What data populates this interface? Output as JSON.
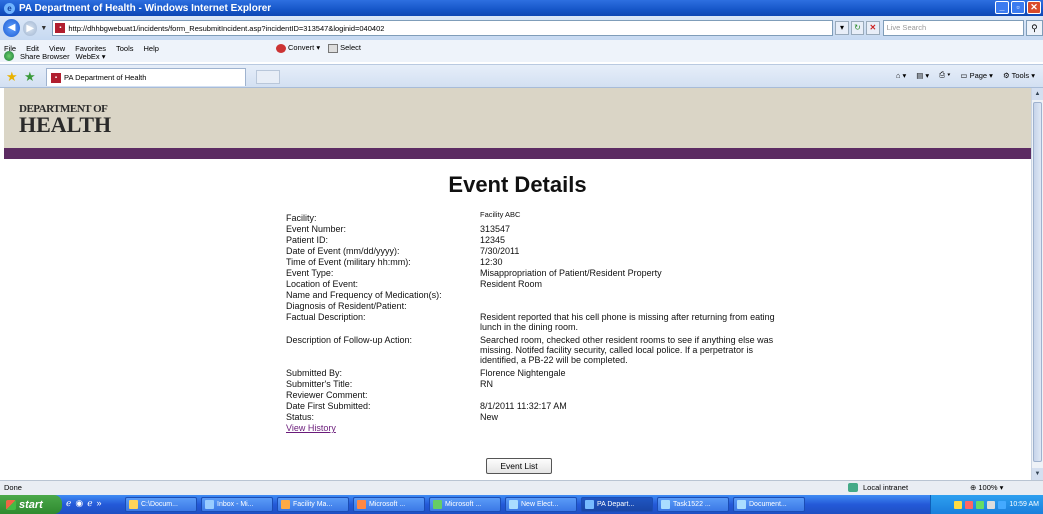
{
  "window": {
    "title": "PA Department of Health - Windows Internet Explorer"
  },
  "address": {
    "url": "http://dhhbgwebuat1/incidents/form_ResubmitIncident.asp?incidentID=313547&loginid=040402",
    "search_placeholder": "Live Search"
  },
  "menu": {
    "items": [
      "File",
      "Edit",
      "View",
      "Favorites",
      "Tools",
      "Help"
    ],
    "convert": "Convert",
    "select": "Select",
    "share": "Share Browser",
    "webex": "WebEx"
  },
  "tab": {
    "label": "PA Department of Health"
  },
  "commandbar": {
    "page": "Page",
    "tools": "Tools"
  },
  "logo": {
    "line1": "DEPARTMENT OF",
    "line2": "HEALTH"
  },
  "page": {
    "heading": "Event Details",
    "fields": [
      {
        "label": "Facility:",
        "value": "Facility ABC"
      },
      {
        "label": "Event Number:",
        "value": "313547"
      },
      {
        "label": "Patient ID:",
        "value": "12345"
      },
      {
        "label": "Date of Event (mm/dd/yyyy):",
        "value": "7/30/2011"
      },
      {
        "label": "Time of Event (military hh:mm):",
        "value": "12:30"
      },
      {
        "label": "Event Type:",
        "value": "Misappropriation of Patient/Resident Property"
      },
      {
        "label": "Location of Event:",
        "value": "Resident Room"
      },
      {
        "label": "Name and Frequency of Medication(s):",
        "value": ""
      },
      {
        "label": "Diagnosis of Resident/Patient:",
        "value": ""
      },
      {
        "label": "Factual Description:",
        "value": "Resident reported that his cell phone is missing after returning from eating lunch in the dining room."
      },
      {
        "label": "Description of Follow-up Action:",
        "value": "Searched room, checked other resident rooms to see if anything else was missing. Notifed facility security, called local police. If a perpetrator is identified, a PB-22 will be completed."
      },
      {
        "label": "Submitted By:",
        "value": "Florence Nightengale"
      },
      {
        "label": "Submitter's Title:",
        "value": "RN"
      },
      {
        "label": "Reviewer Comment:",
        "value": ""
      },
      {
        "label": "Date First Submitted:",
        "value": "8/1/2011 11:32:17 AM"
      },
      {
        "label": "Status:",
        "value": "New"
      }
    ],
    "history_link": "View History",
    "event_list_button": "Event List"
  },
  "status": {
    "text": "Done",
    "zone": "Local intranet",
    "zoom": "100%"
  },
  "taskbar": {
    "start": "start",
    "tasks": [
      "C:\\Docum...",
      "Inbox - Mi...",
      "Facility Ma...",
      "Microsoft ...",
      "Microsoft ...",
      "New Elect...",
      "PA Depart...",
      "Task1522 ...",
      "Document..."
    ],
    "clock": "10:59 AM"
  }
}
